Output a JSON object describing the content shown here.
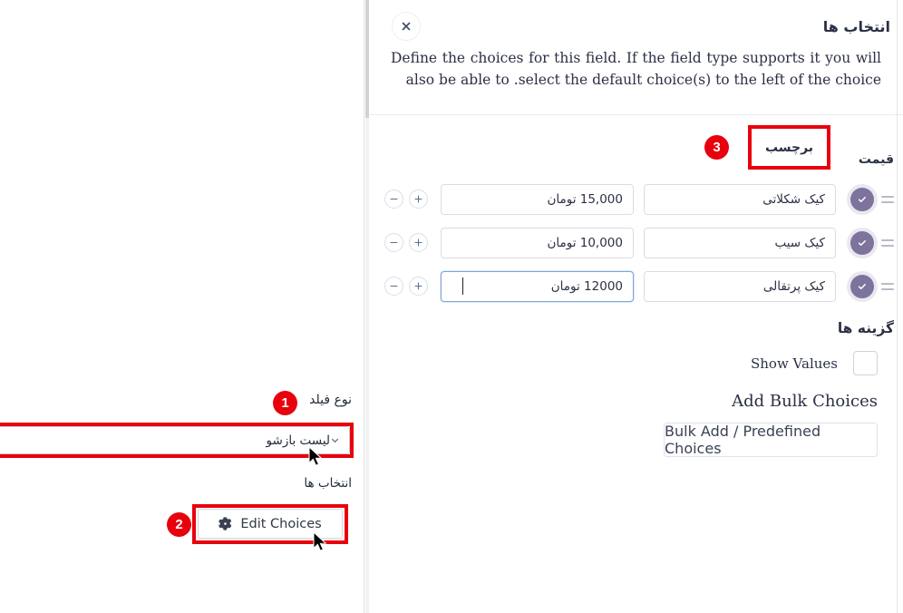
{
  "left_panel": {
    "field_type_label": "نوع فیلد",
    "field_type_value": "لیست بازشو",
    "choices_label": "انتخاب ها",
    "edit_choices_button": "Edit Choices",
    "gear_icon": "gear-icon",
    "chevron_icon": "chevron-down-icon"
  },
  "flyout": {
    "title": "انتخاب ها",
    "close_icon": "close-icon",
    "description_part1": "Define the choices for this field. If the field type supports it you will also be able to",
    "description_part2": ".select the default choice(s) to the left of the choice",
    "columns": {
      "price": "قیمت",
      "label": "برچسب"
    },
    "rows": [
      {
        "label": "کیک شکلاتی",
        "price": "15,000 تومان",
        "selected": true,
        "focused": false
      },
      {
        "label": "کیک سیب",
        "price": "10,000 تومان",
        "selected": true,
        "focused": false
      },
      {
        "label": "کیک پرتقالی",
        "price": "12000 تومان",
        "selected": true,
        "focused": true
      }
    ],
    "row_icons": {
      "drag": "drag-handle-icon",
      "check": "check-circle-icon",
      "add": "plus-icon",
      "remove": "minus-icon"
    },
    "options": {
      "title": "گزینه ها",
      "show_values_label": "Show Values",
      "show_values_checked": false,
      "add_bulk_title": "Add Bulk Choices",
      "bulk_button": "Bulk Add / Predefined Choices"
    }
  },
  "annotations": {
    "badge_1": "1",
    "badge_2": "2",
    "badge_3": "3",
    "color": "#e8000d"
  }
}
